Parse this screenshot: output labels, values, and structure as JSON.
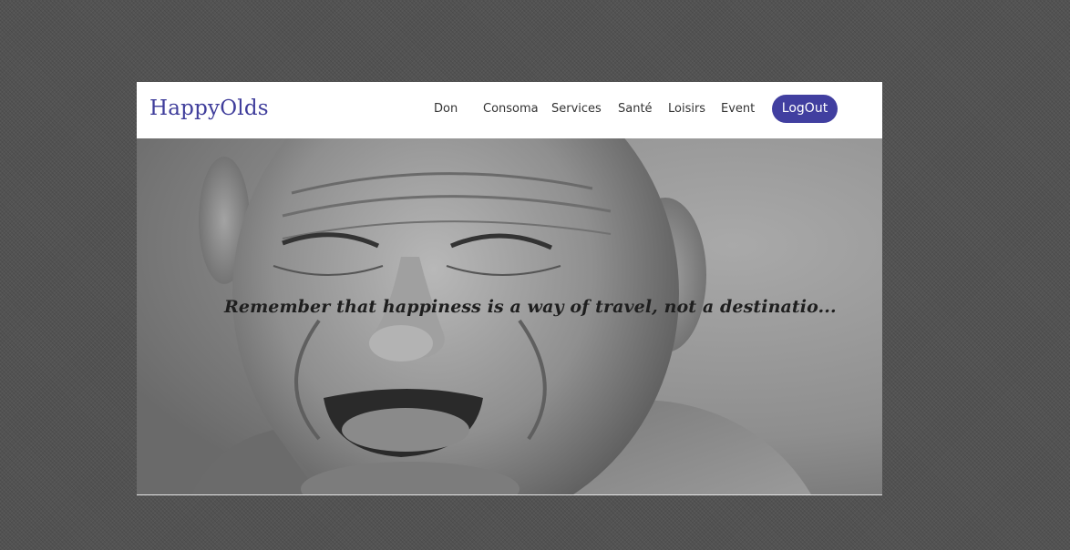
{
  "brand": "HappyOlds",
  "nav": {
    "items": [
      "Don",
      "Consoma",
      "Services",
      "Santé",
      "Loisirs",
      "Event"
    ],
    "logout_label": "LogOut"
  },
  "hero": {
    "image": "smiling-elderly-man-photo",
    "quote": "Remember that happiness is a way of travel, not a destinatio..."
  },
  "colors": {
    "brand": "#3f3d9b",
    "button": "#413fa0",
    "page_background": "#535353"
  }
}
